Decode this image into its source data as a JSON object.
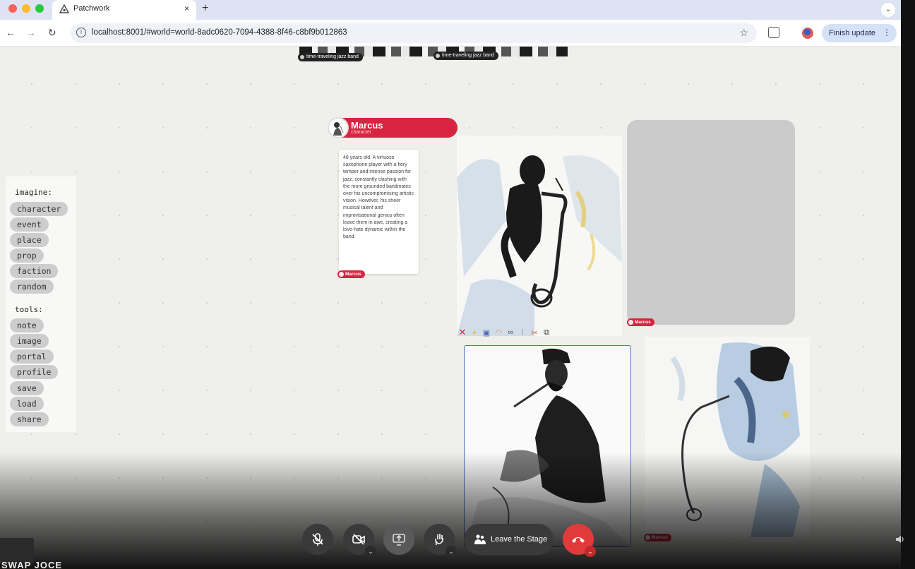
{
  "browser": {
    "tab_title": "Patchwork",
    "url": "localhost:8001/#world=world-8adc0620-7094-4388-8f46-c8bf9b012863",
    "finish_update": "Finish update",
    "close_glyph": "×",
    "new_tab_glyph": "+",
    "tab_menu_glyph": "⌄",
    "back_glyph": "←",
    "forward_glyph": "→",
    "reload_glyph": "↻",
    "star_glyph": "☆",
    "menu_dots": "⋮"
  },
  "canvas": {
    "top_tags": [
      "time-traveling jazz band",
      "time-traveling jazz band"
    ],
    "panel": {
      "imagine_heading": "imagine:",
      "imagine_items": [
        "character",
        "event",
        "place",
        "prop",
        "faction",
        "random"
      ],
      "tools_heading": "tools:",
      "tools_items": [
        "note",
        "image",
        "portal",
        "profile",
        "save",
        "load",
        "share"
      ]
    },
    "character": {
      "name": "Marcus",
      "type": "character",
      "description": "48 years old. A virtuoso saxophone player with a fiery temper and intense passion for jazz, constantly clashing with the more grounded bandmates over his uncompromising artistic vision. However, his sheer musical talent and improvisational genius often leave them in awe, creating a love-hate dynamic within the band.",
      "tag": "Marcus"
    },
    "image_tags": [
      "Marcus",
      "Marcus"
    ],
    "image_toolbar_icons": [
      "delete-icon",
      "lightbulb-icon",
      "frame-icon",
      "rainbow-icon",
      "link-icon",
      "sliders-icon",
      "shuffle-icon",
      "duplicate-icon"
    ],
    "accent": "#d72541"
  },
  "call": {
    "leave_label": "Leave the Stage",
    "bottom_text": "SWAP JOCE",
    "hangup_color": "#e03a3a"
  }
}
